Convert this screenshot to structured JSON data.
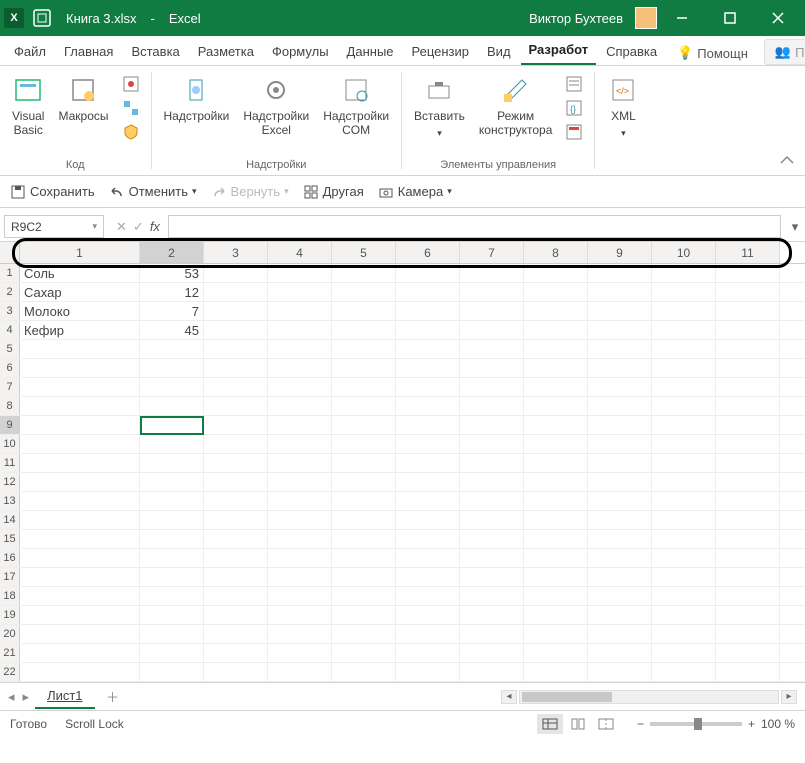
{
  "titlebar": {
    "filename": "Книга 3.xlsx",
    "app_sep": "-",
    "app_name": "Excel",
    "user": "Виктор Бухтеев"
  },
  "tabs": {
    "file": "Файл",
    "home": "Главная",
    "insert": "Вставка",
    "layout": "Разметка",
    "formulas": "Формулы",
    "data": "Данные",
    "review": "Рецензир",
    "view": "Вид",
    "developer": "Разработ",
    "help": "Справка",
    "help_btn": "Помощн",
    "share": "Поделиться"
  },
  "ribbon": {
    "code": {
      "visual_basic": "Visual\nBasic",
      "macros": "Макросы",
      "group": "Код"
    },
    "addins": {
      "addins": "Надстройки",
      "excel_addins": "Надстройки\nExcel",
      "com_addins": "Надстройки\nCOM",
      "group": "Надстройки"
    },
    "controls": {
      "insert": "Вставить",
      "design_mode": "Режим\nконструктора",
      "group": "Элементы управления"
    },
    "xml": {
      "xml": "XML",
      "group": ""
    }
  },
  "qat": {
    "save": "Сохранить",
    "undo": "Отменить",
    "redo": "Вернуть",
    "other": "Другая",
    "camera": "Камера"
  },
  "namebox": "R9C2",
  "columns": [
    "1",
    "2",
    "3",
    "4",
    "5",
    "6",
    "7",
    "8",
    "9",
    "10",
    "11"
  ],
  "row_headers": [
    "1",
    "2",
    "3",
    "4",
    "5",
    "6",
    "7",
    "8",
    "9",
    "10",
    "11",
    "12",
    "13",
    "14",
    "15",
    "16",
    "17",
    "18",
    "19",
    "20",
    "21",
    "22"
  ],
  "cells": {
    "r1c1": "Соль",
    "r1c2": "53",
    "r2c1": "Сахар",
    "r2c2": "12",
    "r3c1": "Молоко",
    "r3c2": "7",
    "r4c1": "Кефир",
    "r4c2": "45"
  },
  "sheet": {
    "tab1": "Лист1"
  },
  "status": {
    "ready": "Готово",
    "scroll_lock": "Scroll Lock",
    "zoom": "100 %"
  }
}
